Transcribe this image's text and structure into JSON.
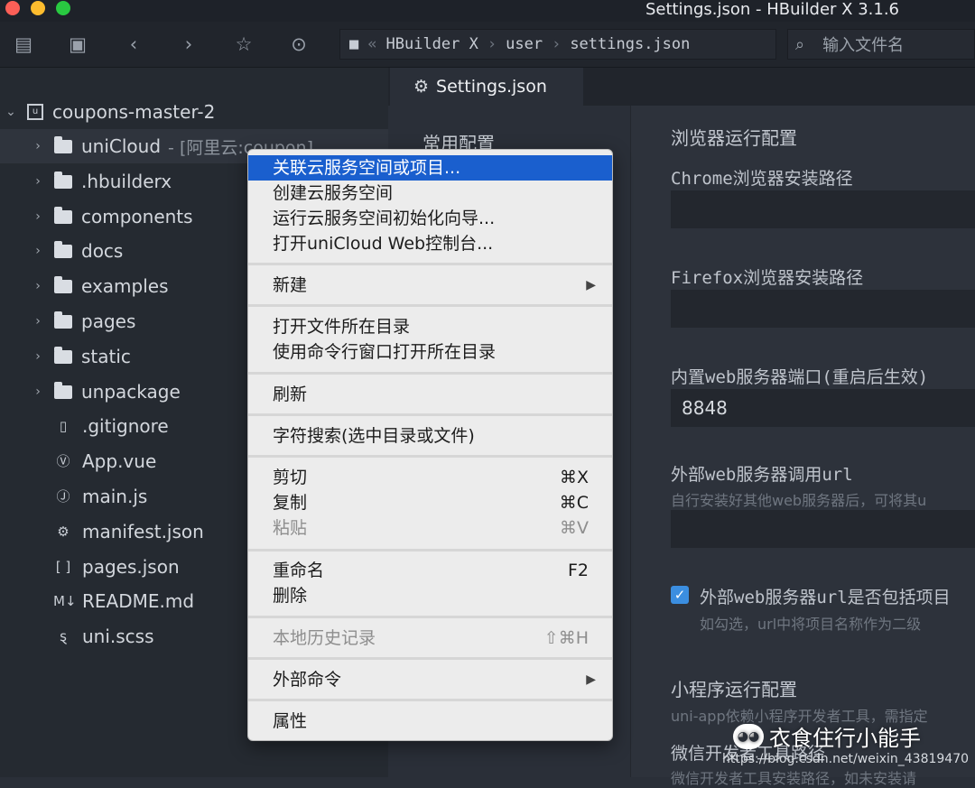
{
  "window": {
    "title": "Settings.json - HBuilder X 3.1.6"
  },
  "toolbar": {
    "breadcrumb": [
      "HBuilder X",
      "user",
      "settings.json"
    ],
    "search_placeholder": "输入文件名"
  },
  "sidebar": {
    "project": "coupons-master-2",
    "items": [
      {
        "label": "uniCloud",
        "sublabel": "- [阿里云:coupon]",
        "type": "folder",
        "icon": "cloud-folder-icon"
      },
      {
        "label": ".hbuilderx",
        "type": "folder",
        "icon": "folder-icon"
      },
      {
        "label": "components",
        "type": "folder",
        "icon": "folder-icon"
      },
      {
        "label": "docs",
        "type": "folder",
        "icon": "folder-icon"
      },
      {
        "label": "examples",
        "type": "folder",
        "icon": "folder-icon"
      },
      {
        "label": "pages",
        "type": "folder",
        "icon": "folder-icon"
      },
      {
        "label": "static",
        "type": "folder",
        "icon": "folder-icon"
      },
      {
        "label": "unpackage",
        "type": "folder",
        "icon": "folder-icon"
      },
      {
        "label": ".gitignore",
        "type": "file",
        "icon": "file-icon"
      },
      {
        "label": "App.vue",
        "type": "file",
        "icon": "vue-file-icon"
      },
      {
        "label": "main.js",
        "type": "file",
        "icon": "js-file-icon"
      },
      {
        "label": "manifest.json",
        "type": "file",
        "icon": "manifest-file-icon"
      },
      {
        "label": "pages.json",
        "type": "file",
        "icon": "json-file-icon"
      },
      {
        "label": "README.md",
        "type": "file",
        "icon": "markdown-file-icon"
      },
      {
        "label": "uni.scss",
        "type": "file",
        "icon": "scss-file-icon"
      }
    ]
  },
  "editor": {
    "tab": "Settings.json",
    "nav_item": "常用配置",
    "browser_heading": "浏览器运行配置",
    "chrome_label": "Chrome浏览器安装路径",
    "firefox_label": "Firefox浏览器安装路径",
    "port_label": "内置web服务器端口(重启后生效)",
    "port_value": "8848",
    "external_url_label": "外部web服务器调用url",
    "external_url_desc": "自行安装好其他web服务器后，可将其u",
    "include_project_label": "外部web服务器url是否包括项目",
    "include_project_desc": "如勾选，url中将项目名称作为二级",
    "include_project_checked": true,
    "miniprogram_heading": "小程序运行配置",
    "miniprogram_desc": "uni-app依赖小程序开发者工具，需指定",
    "wechat_label": "微信开发者工具路径",
    "wechat_desc": "微信开发者工具安装路径，如未安装请"
  },
  "context_menu": {
    "items": [
      {
        "label": "关联云服务空间或项目...",
        "highlight": true
      },
      {
        "label": "创建云服务空间"
      },
      {
        "label": "运行云服务空间初始化向导..."
      },
      {
        "label": "打开uniCloud Web控制台..."
      },
      {
        "label": "新建",
        "submenu": true
      },
      {
        "label": "打开文件所在目录"
      },
      {
        "label": "使用命令行窗口打开所在目录"
      },
      {
        "label": "刷新"
      },
      {
        "label": "字符搜索(选中目录或文件)"
      },
      {
        "label": "剪切",
        "shortcut": "⌘X"
      },
      {
        "label": "复制",
        "shortcut": "⌘C"
      },
      {
        "label": "粘贴",
        "shortcut": "⌘V",
        "disabled": true
      },
      {
        "label": "重命名",
        "shortcut": "F2"
      },
      {
        "label": "删除"
      },
      {
        "label": "本地历史记录",
        "shortcut": "⇧⌘H",
        "disabled": true
      },
      {
        "label": "外部命令",
        "submenu": true
      },
      {
        "label": "属性"
      }
    ]
  },
  "watermark": {
    "name": "衣食住行小能手",
    "url": "https://blog.csdn.net/weixin_43819470"
  },
  "colors": {
    "highlight": "#1a5fce",
    "checkbox": "#3b8ee0"
  }
}
